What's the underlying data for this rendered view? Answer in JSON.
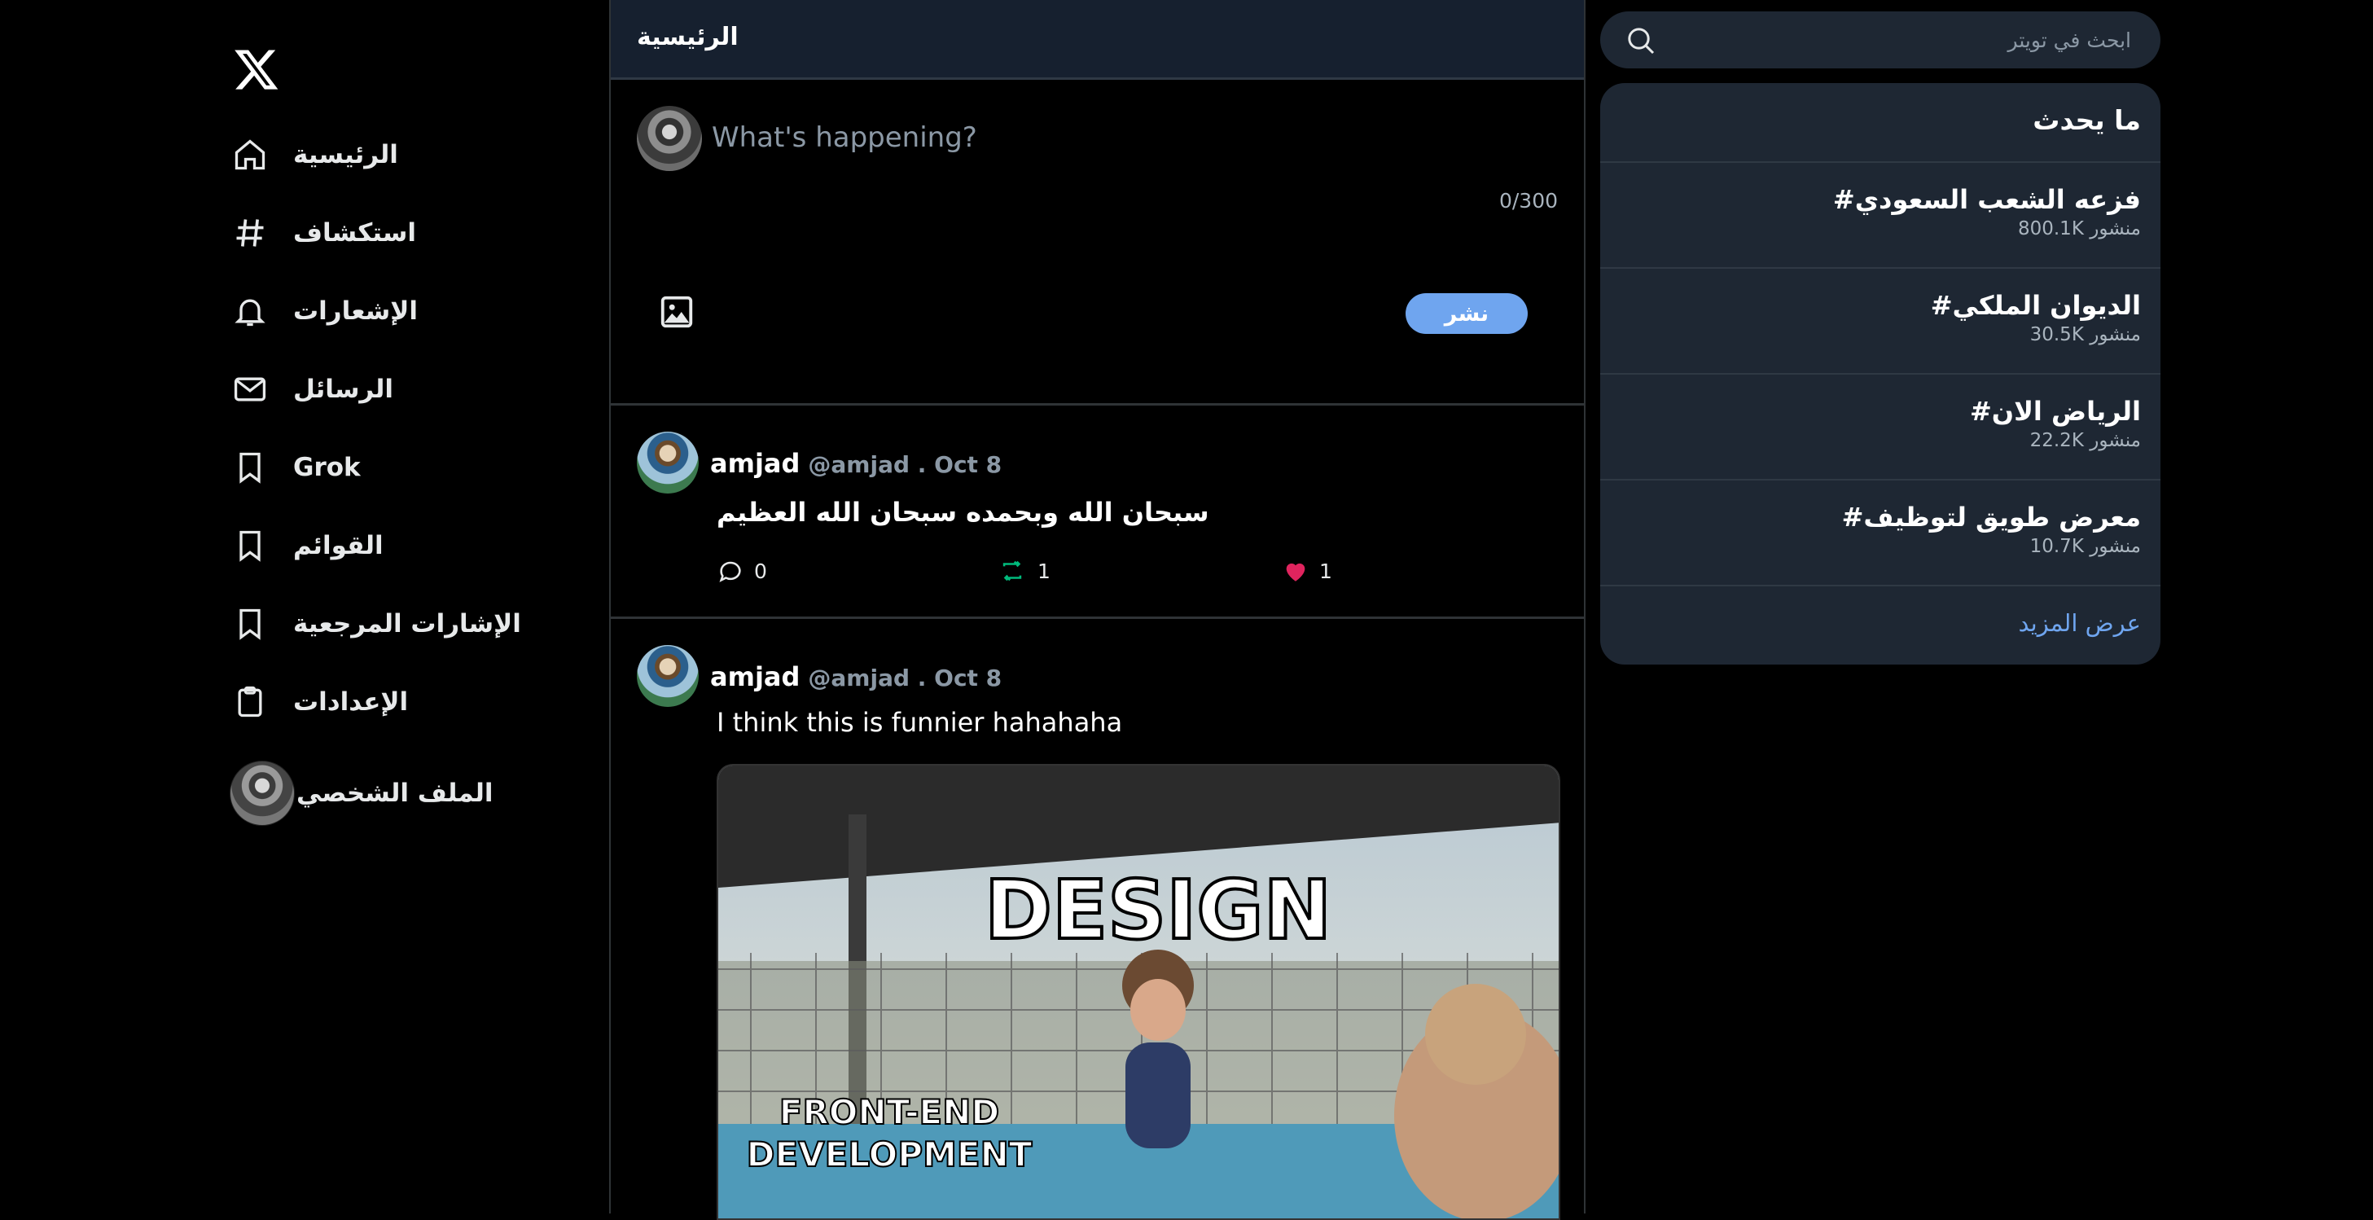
{
  "nav": {
    "logo_icon": "x-logo-icon",
    "items": [
      {
        "label": "الرئيسية",
        "icon": "home-icon"
      },
      {
        "label": "استكشاف",
        "icon": "hashtag-icon"
      },
      {
        "label": "الإشعارات",
        "icon": "bell-icon"
      },
      {
        "label": "الرسائل",
        "icon": "mail-icon"
      },
      {
        "label": "Grok",
        "icon": "bookmark-icon"
      },
      {
        "label": "القوائم",
        "icon": "bookmark-icon"
      },
      {
        "label": "الإشارات المرجعية",
        "icon": "bookmark-icon"
      },
      {
        "label": "الإعدادات",
        "icon": "clipboard-icon"
      }
    ],
    "profile_label": "الملف الشخصي"
  },
  "header": {
    "title": "الرئيسية"
  },
  "composer": {
    "placeholder": "What's happening?",
    "char_count": "0/300",
    "post_label": "نشر"
  },
  "tweets": [
    {
      "name": "amjad",
      "handle_date": "@amjad . Oct 8",
      "text": "سبحان الله وبحمده سبحان الله العظيم",
      "replies": "0",
      "retweets": "1",
      "likes": "1"
    },
    {
      "name": "amjad",
      "handle_date": "@amjad . Oct 8",
      "text": "I think this is funnier hahahaha",
      "image": {
        "caption_top": "DESIGN",
        "caption_bottom_1": "FRONT-END",
        "caption_bottom_2": "DEVELOPMENT"
      }
    }
  ],
  "search": {
    "placeholder": "ابحث في تويتر"
  },
  "trends": {
    "title": "ما يحدث",
    "items": [
      {
        "tag": "#فزعه الشعب السعودي",
        "count": "800.1K منشور"
      },
      {
        "tag": "#الديوان الملكي",
        "count": "30.5K منشور"
      },
      {
        "tag": "#الرياض الان",
        "count": "22.2K منشور"
      },
      {
        "tag": "#معرض طويق لتوظيف",
        "count": "10.7K منشور"
      }
    ],
    "show_more": "عرض المزيد"
  },
  "colors": {
    "background": "#000000",
    "panel": "#1e2733",
    "header": "#16202f",
    "accent": "#6fa5ef",
    "retweet": "#00ba7c",
    "like": "#f91880"
  }
}
